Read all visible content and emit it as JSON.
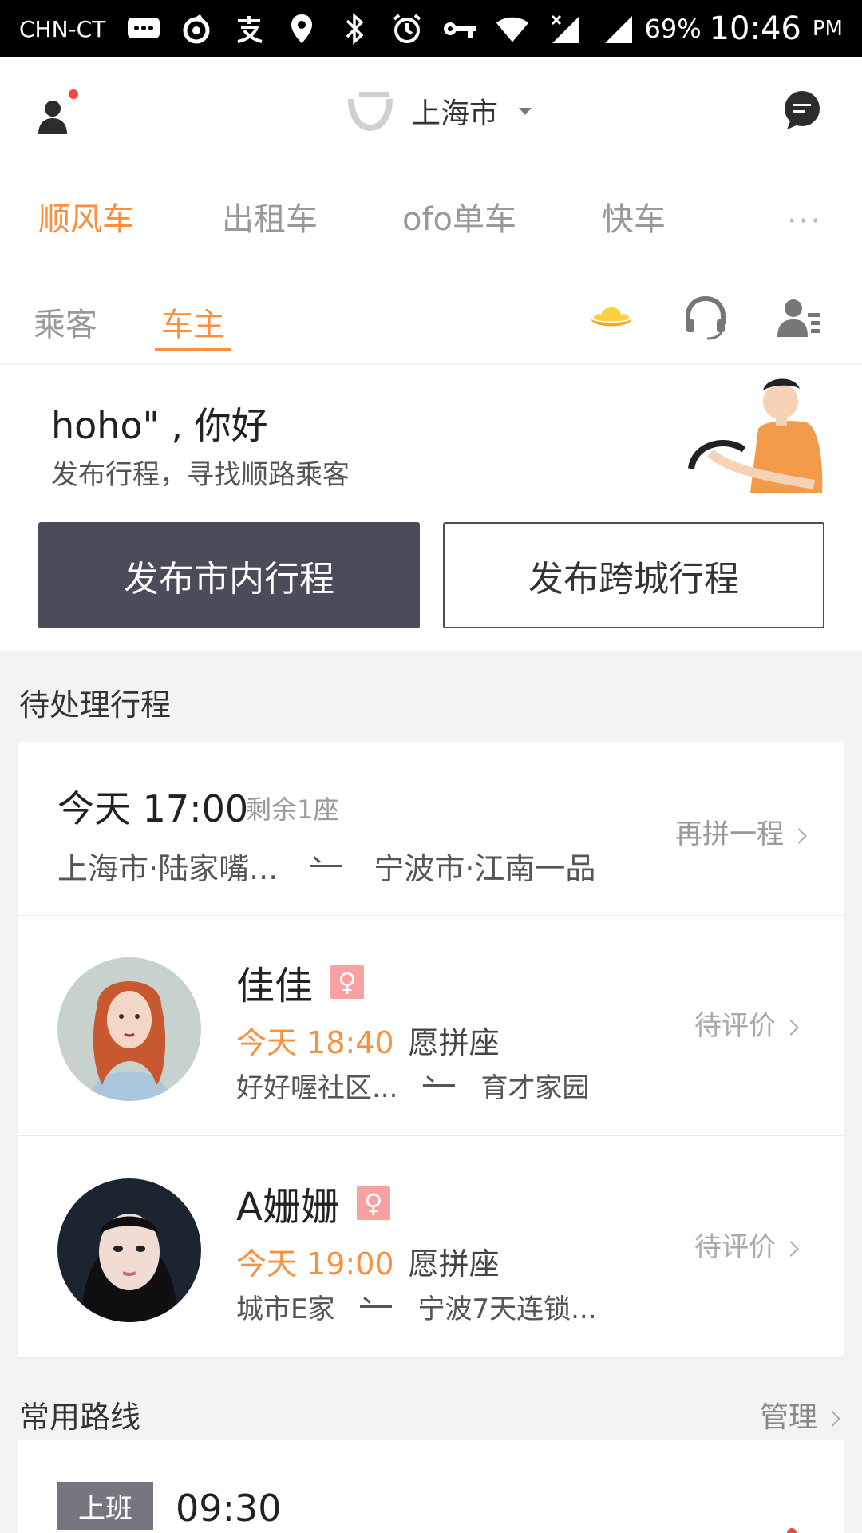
{
  "status_bar": {
    "carrier": "CHN-CT",
    "battery": "69%",
    "time": "10:46",
    "ampm": "PM",
    "icons": [
      "message-icon",
      "netease-music-icon",
      "alipay-icon",
      "location-icon",
      "bluetooth-icon",
      "alarm-icon",
      "vpn-key-icon",
      "wifi-icon",
      "signal-x-icon",
      "signal-icon"
    ]
  },
  "header": {
    "city": "上海市"
  },
  "service_tabs": [
    "顺风车",
    "出租车",
    "ofo单车",
    "快车",
    "···"
  ],
  "role_tabs": [
    "乘客",
    "车主"
  ],
  "greeting": {
    "title": "hoho\" , 你好",
    "subtitle": "发布行程，寻找顺路乘客",
    "btn_city": "发布市内行程",
    "btn_intercity": "发布跨城行程"
  },
  "pending": {
    "title": "待处理行程",
    "trip": {
      "time": "今天 17:00",
      "seats": "剩余1座",
      "from": "上海市·陆家嘴...",
      "to": "宁波市·江南一品",
      "action": "再拼一程"
    },
    "passengers": [
      {
        "name": "佳佳",
        "gender": "♀",
        "time": "今天 18:40",
        "share": "愿拼座",
        "from": "好好喔社区...",
        "to": "育才家园",
        "action": "待评价"
      },
      {
        "name": "A姗姗",
        "gender": "♀",
        "time": "今天 19:00",
        "share": "愿拼座",
        "from": "城市E家",
        "to": "宁波7天连锁...",
        "action": "待评价"
      }
    ]
  },
  "routes": {
    "title": "常用路线",
    "action": "管理",
    "items": [
      {
        "tag": "上班",
        "time": "09:30"
      }
    ]
  },
  "colors": {
    "accent": "#fa8f3e",
    "dark_button": "#4b4c5a",
    "female_badge": "#f7a1a1"
  }
}
